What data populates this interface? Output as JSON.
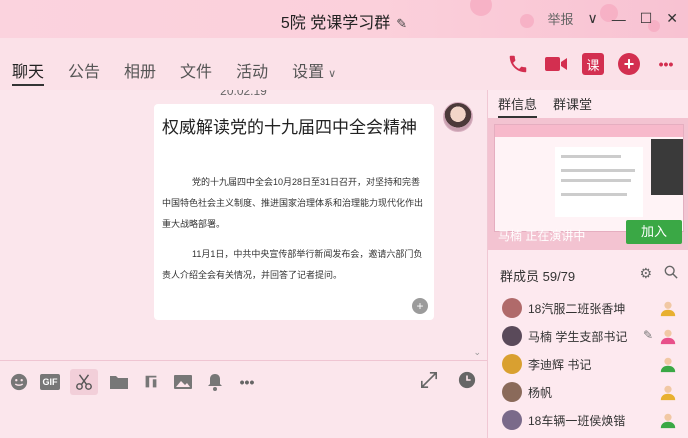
{
  "window": {
    "title": "5院 党课学习群",
    "report_label": "举报",
    "controls": [
      "∨",
      "—",
      "☐",
      "✕"
    ]
  },
  "tabs": [
    {
      "label": "聊天",
      "active": true
    },
    {
      "label": "公告",
      "active": false
    },
    {
      "label": "相册",
      "active": false
    },
    {
      "label": "文件",
      "active": false
    },
    {
      "label": "活动",
      "active": false
    },
    {
      "label": "设置",
      "active": false
    }
  ],
  "actions": {
    "course_label": "课",
    "add_label": "+",
    "more_label": "•••"
  },
  "chat": {
    "timestamp": "20:02:19",
    "message": {
      "title": "权威解读党的十九届四中全会精神",
      "paragraph1": "党的十九届四中全会10月28日至31日召开，对坚持和完善中国特色社会主义制度、推进国家治理体系和治理能力现代化作出重大战略部署。",
      "paragraph2": "11月1日，中共中央宣传部举行新闻发布会，邀请六部门负责人介绍全会有关情况，并回答了记者提问。"
    }
  },
  "toolbar": {
    "gif_label": "GIF"
  },
  "right_panel": {
    "tabs": [
      {
        "label": "群信息",
        "active": true
      },
      {
        "label": "群课堂",
        "active": false
      }
    ],
    "live": {
      "presenter_text": "马楠 正在演讲中",
      "join_label": "加入"
    },
    "members_header": "群成员 59/79",
    "members": [
      {
        "name": "18汽服二班张香坤",
        "avatar_color": "#b06a6a",
        "badge_color": "#e8b030"
      },
      {
        "name": "马楠 学生支部书记",
        "avatar_color": "#5a4a5a",
        "badge_color": "#e8508a"
      },
      {
        "name": "李迪辉 书记",
        "avatar_color": "#d9a030",
        "badge_color": "#3aa845"
      },
      {
        "name": "杨帆",
        "avatar_color": "#8a6a5a",
        "badge_color": "#e8b030"
      },
      {
        "name": "18车辆一班侯焕锴",
        "avatar_color": "#7a6a8a",
        "badge_color": "#3aa845"
      }
    ]
  },
  "colors": {
    "accent": "#d32f50",
    "join_green": "#3aa845",
    "background": "#fde3ea"
  }
}
